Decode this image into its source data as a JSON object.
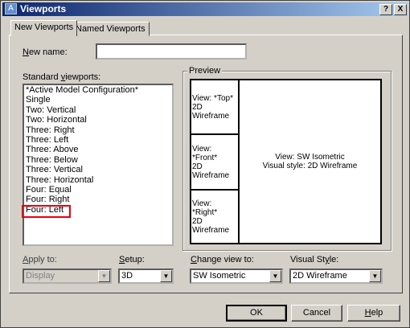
{
  "window": {
    "title": "Viewports",
    "help_button": "?",
    "close_button": "X"
  },
  "tabs": [
    {
      "label": "New Viewports",
      "active": true
    },
    {
      "label": "Named Viewports",
      "active": false
    }
  ],
  "new_name": {
    "label": "New name:",
    "mnemonic": "N",
    "value": ""
  },
  "standard_viewports": {
    "label": "Standard viewports:",
    "items": [
      "*Active Model Configuration*",
      "Single",
      "Two:  Vertical",
      "Two:  Horizontal",
      "Three: Right",
      "Three: Left",
      "Three: Above",
      "Three: Below",
      "Three: Vertical",
      "Three: Horizontal",
      "Four:  Equal",
      "Four:  Right",
      "Four:  Left"
    ],
    "highlighted": "Four:  Left"
  },
  "preview": {
    "label": "Preview",
    "viewports": [
      {
        "view": "View: *Top*",
        "style": "2D Wireframe"
      },
      {
        "view": "View: *Front*",
        "style": "2D Wireframe"
      },
      {
        "view": "View: *Right*",
        "style": "2D Wireframe"
      },
      {
        "view": "View: SW Isometric",
        "style": "Visual style: 2D Wireframe"
      }
    ]
  },
  "apply_to": {
    "label": "Apply to:",
    "value": "Display",
    "disabled": true
  },
  "setup": {
    "label": "Setup:",
    "value": "3D"
  },
  "change_view": {
    "label": "Change view to:",
    "value": "SW Isometric"
  },
  "visual_style": {
    "label": "Visual Style:",
    "value": "2D Wireframe"
  },
  "buttons": {
    "ok": "OK",
    "cancel": "Cancel",
    "help": "Help"
  },
  "colors": {
    "title_start": "#0a246a",
    "title_end": "#a6caf0",
    "highlight_box": "#e8000f",
    "face": "#d4d0c8"
  }
}
